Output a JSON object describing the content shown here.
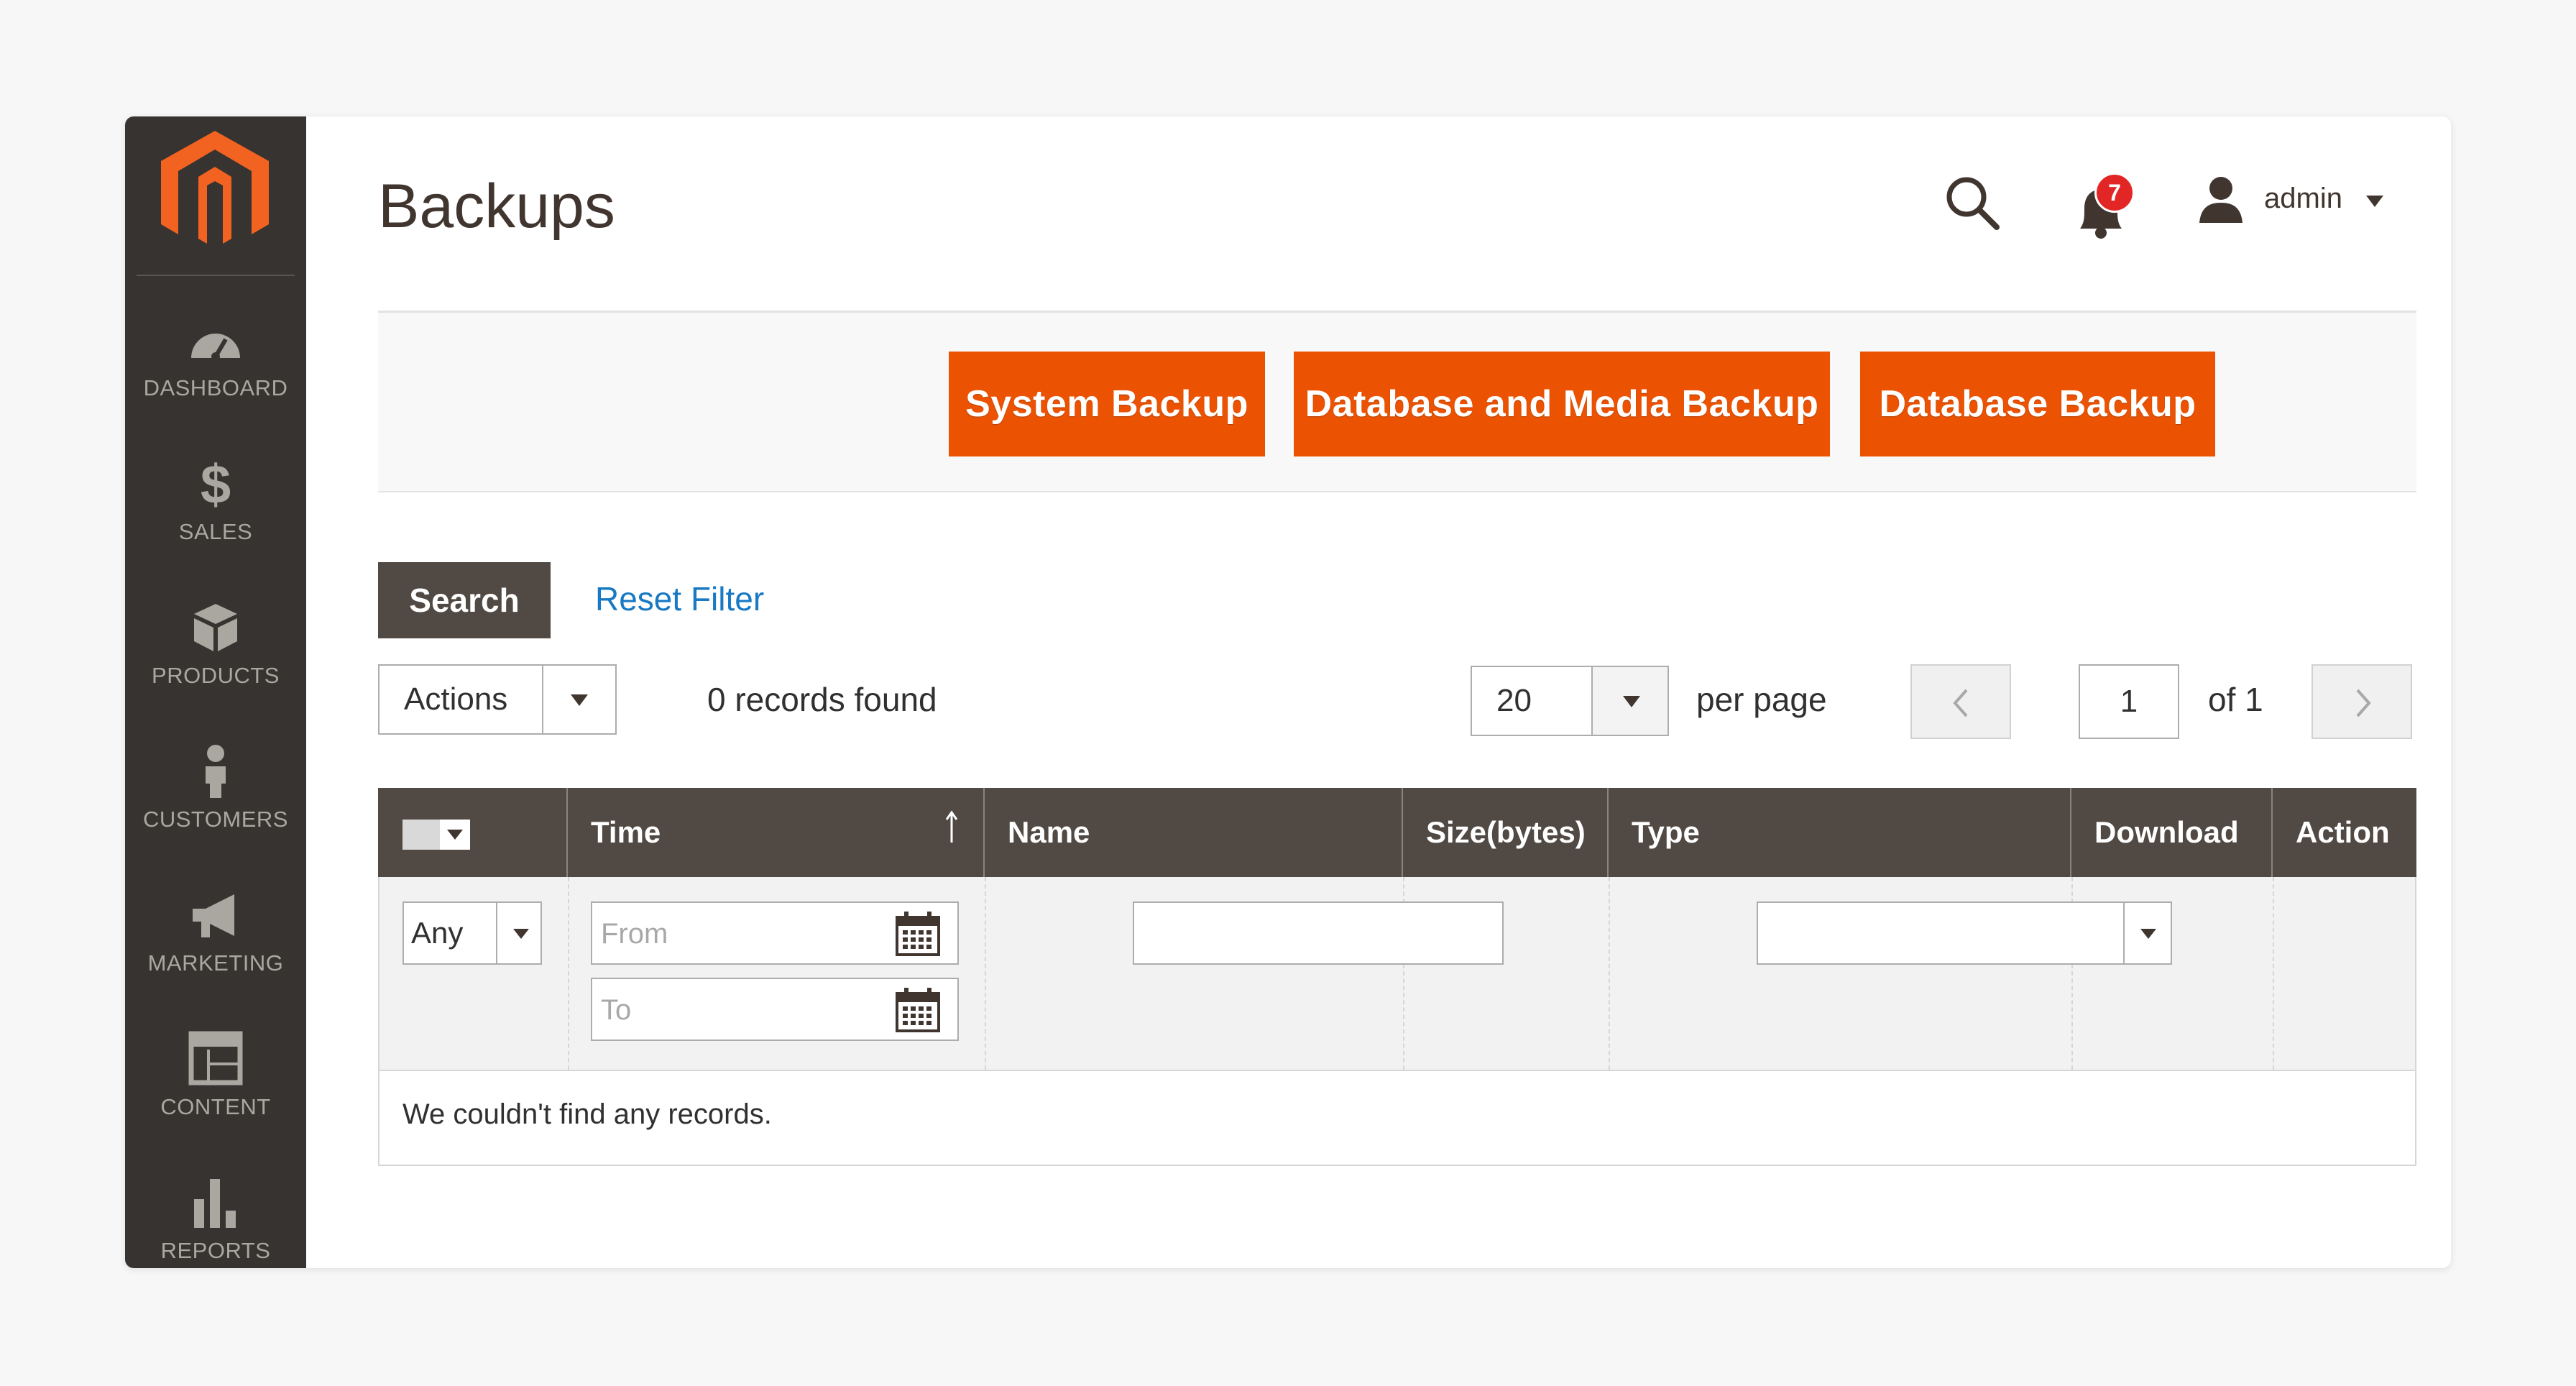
{
  "page": {
    "title": "Backups"
  },
  "sidebar": {
    "logo": "magento-logo",
    "items": [
      {
        "label": "DASHBOARD",
        "icon": "dashboard-gauge-icon"
      },
      {
        "label": "SALES",
        "icon": "dollar-icon"
      },
      {
        "label": "PRODUCTS",
        "icon": "box-icon"
      },
      {
        "label": "CUSTOMERS",
        "icon": "person-icon"
      },
      {
        "label": "MARKETING",
        "icon": "megaphone-icon"
      },
      {
        "label": "CONTENT",
        "icon": "layout-icon"
      },
      {
        "label": "REPORTS",
        "icon": "bar-chart-icon"
      }
    ]
  },
  "header": {
    "notifications_count": "7",
    "user_name": "admin"
  },
  "actions": {
    "system_backup": "System Backup",
    "db_media_backup": "Database and Media Backup",
    "db_backup": "Database Backup"
  },
  "filters": {
    "search_label": "Search",
    "reset_label": "Reset Filter",
    "mass_action_value": "Actions",
    "records_found": "0 records found",
    "per_page_value": "20",
    "per_page_label": "per page",
    "current_page": "1",
    "page_of": "of 1"
  },
  "grid": {
    "columns": {
      "time": "Time",
      "name": "Name",
      "size": "Size(bytes)",
      "type": "Type",
      "download": "Download",
      "action": "Action"
    },
    "filter_any": "Any",
    "filter_from_placeholder": "From",
    "filter_to_placeholder": "To",
    "empty_message": "We couldn't find any records."
  },
  "colors": {
    "accent": "#eb5202",
    "sidebar_bg": "#373330",
    "header_bg": "#514943",
    "link": "#1979c3",
    "badge": "#e22626"
  }
}
